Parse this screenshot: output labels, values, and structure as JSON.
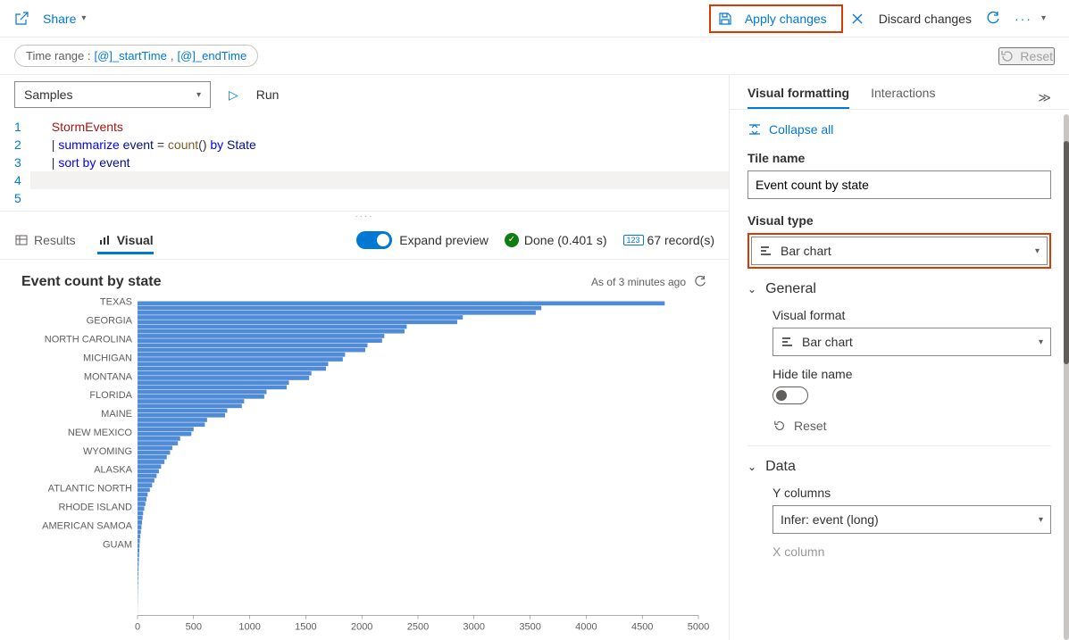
{
  "topbar": {
    "share": "Share",
    "apply": "Apply changes",
    "discard": "Discard changes"
  },
  "time_pill": {
    "prefix": "Time range :",
    "v1": "[@]_startTime",
    "sep": ", ",
    "v2": "[@]_endTime"
  },
  "pill_reset": "Reset",
  "db": "Samples",
  "run": "Run",
  "editor": {
    "lines": [
      "1",
      "2",
      "3",
      "4",
      "5"
    ],
    "l1_ident": "StormEvents",
    "l2_pipe": "| ",
    "l2_kw": "summarize",
    "l2_var": " event ",
    "l2_eq": "= ",
    "l2_fn": "count",
    "l2_paren": "() ",
    "l2_by": "by",
    "l2_state": " State",
    "l3_pipe": "| ",
    "l3_kw": "sort",
    "l3_by": " by",
    "l3_var": " event"
  },
  "results": {
    "tab_results": "Results",
    "tab_visual": "Visual",
    "expand": "Expand preview",
    "done": "Done (0.401 s)",
    "records": "67 record(s)"
  },
  "chart_header": {
    "title": "Event count by state",
    "asof": "As of 3 minutes ago"
  },
  "chart_data": {
    "type": "bar",
    "orientation": "horizontal",
    "title": "Event count by state",
    "xlabel": "",
    "ylabel": "",
    "xlim": [
      0,
      5000
    ],
    "xticks": [
      0,
      500,
      1000,
      1500,
      2000,
      2500,
      3000,
      3500,
      4000,
      4500,
      5000
    ],
    "labeled_categories": [
      "TEXAS",
      "GEORGIA",
      "NORTH CAROLINA",
      "MICHIGAN",
      "MONTANA",
      "FLORIDA",
      "MAINE",
      "NEW MEXICO",
      "WYOMING",
      "ALASKA",
      "ATLANTIC NORTH",
      "RHODE ISLAND",
      "AMERICAN SAMOA",
      "GUAM"
    ],
    "series": [
      {
        "name": "event",
        "values": [
          4700,
          3600,
          3550,
          2900,
          2850,
          2400,
          2380,
          2200,
          2180,
          2050,
          2030,
          1850,
          1830,
          1700,
          1680,
          1550,
          1530,
          1350,
          1330,
          1150,
          1130,
          950,
          930,
          800,
          780,
          620,
          600,
          500,
          480,
          380,
          360,
          310,
          290,
          260,
          240,
          210,
          190,
          170,
          150,
          130,
          110,
          90,
          80,
          70,
          60,
          50,
          45,
          40,
          35,
          30,
          25,
          20,
          18,
          16,
          14,
          12,
          10,
          8,
          7,
          6,
          5,
          4,
          3,
          2,
          2,
          1,
          1
        ]
      }
    ],
    "label_slots": [
      0,
      4,
      8,
      12,
      16,
      20,
      24,
      28,
      32,
      36,
      40,
      44,
      48,
      52
    ]
  },
  "right": {
    "tab_visual": "Visual formatting",
    "tab_inter": "Interactions",
    "collapse": "Collapse all",
    "tile_name_label": "Tile name",
    "tile_name_value": "Event count by state",
    "visual_type_label": "Visual type",
    "visual_type_value": "Bar chart",
    "sections": {
      "general": "General",
      "visual_format": "Visual format",
      "visual_format_value": "Bar chart",
      "hide_tile": "Hide tile name",
      "reset": "Reset",
      "data": "Data",
      "ycols": "Y columns",
      "ycols_value": "Infer: event (long)",
      "xcol": "X column"
    }
  }
}
